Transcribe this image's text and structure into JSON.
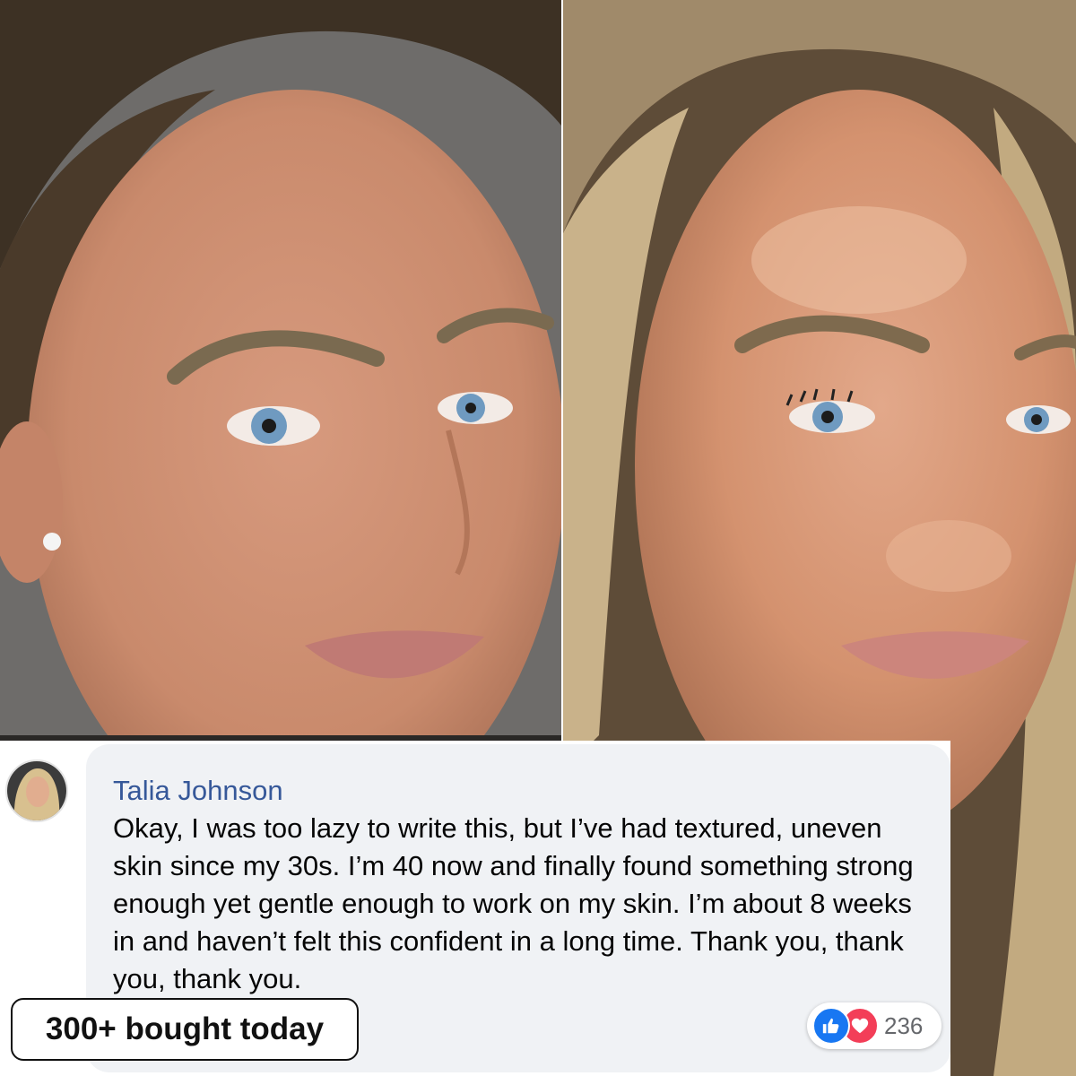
{
  "photos": {
    "before_alt": "before photo",
    "after_alt": "after photo"
  },
  "comment": {
    "author": "Talia Johnson",
    "text": "Okay, I was too lazy to write this, but I’ve had textured, uneven skin since my 30s. I’m 40 now and finally found something strong enough yet gentle enough to work on my skin. I’m about 8 weeks in and haven’t felt this confident in a long time. Thank you, thank you, thank you.",
    "reactions": {
      "count": "236",
      "icons": [
        "like-icon",
        "love-icon"
      ]
    }
  },
  "badge": {
    "label": "300+ bought today"
  },
  "colors": {
    "author_link": "#365899",
    "like": "#1877f2",
    "love": "#f33e58",
    "comment_bg": "#f0f2f5"
  }
}
